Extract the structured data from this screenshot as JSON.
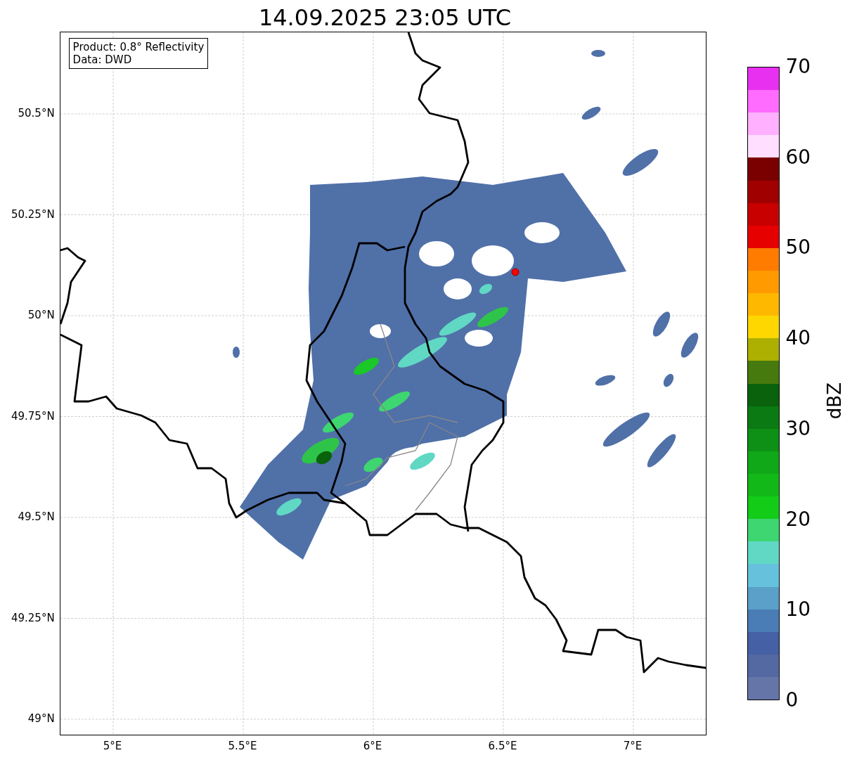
{
  "title": "14.09.2025 23:05 UTC",
  "info_box": [
    "Product: 0.8° Reflectivity",
    "Data: DWD"
  ],
  "lat_ticks": [
    "50.5°N",
    "50.25°N",
    "50°N",
    "49.75°N",
    "49.5°N",
    "49.25°N",
    "49°N"
  ],
  "lon_ticks": [
    "5°E",
    "5.5°E",
    "6°E",
    "6.5°E",
    "7°E"
  ],
  "colorbar": {
    "label": "dBZ",
    "ticks": [
      "70",
      "60",
      "50",
      "40",
      "30",
      "20",
      "10",
      "0"
    ],
    "bands": [
      {
        "color": "#e830f0"
      },
      {
        "color": "#ff6cff"
      },
      {
        "color": "#ffb0ff"
      },
      {
        "color": "#ffdeff"
      },
      {
        "color": "#7a0000"
      },
      {
        "color": "#a00000"
      },
      {
        "color": "#c80000"
      },
      {
        "color": "#e60000"
      },
      {
        "color": "#ff7c00"
      },
      {
        "color": "#ff9a00"
      },
      {
        "color": "#ffb800"
      },
      {
        "color": "#ffd700"
      },
      {
        "color": "#adb000"
      },
      {
        "color": "#477a0e"
      },
      {
        "color": "#0a620c"
      },
      {
        "color": "#0c7a12"
      },
      {
        "color": "#0e9016"
      },
      {
        "color": "#10a818"
      },
      {
        "color": "#12b818"
      },
      {
        "color": "#12cc18"
      },
      {
        "color": "#3ed670"
      },
      {
        "color": "#60d8c4"
      },
      {
        "color": "#66c2dc"
      },
      {
        "color": "#5aa0c8"
      },
      {
        "color": "#4a7cb5"
      },
      {
        "color": "#4560a5"
      },
      {
        "color": "#5468a2"
      },
      {
        "color": "#6675a8"
      }
    ]
  }
}
